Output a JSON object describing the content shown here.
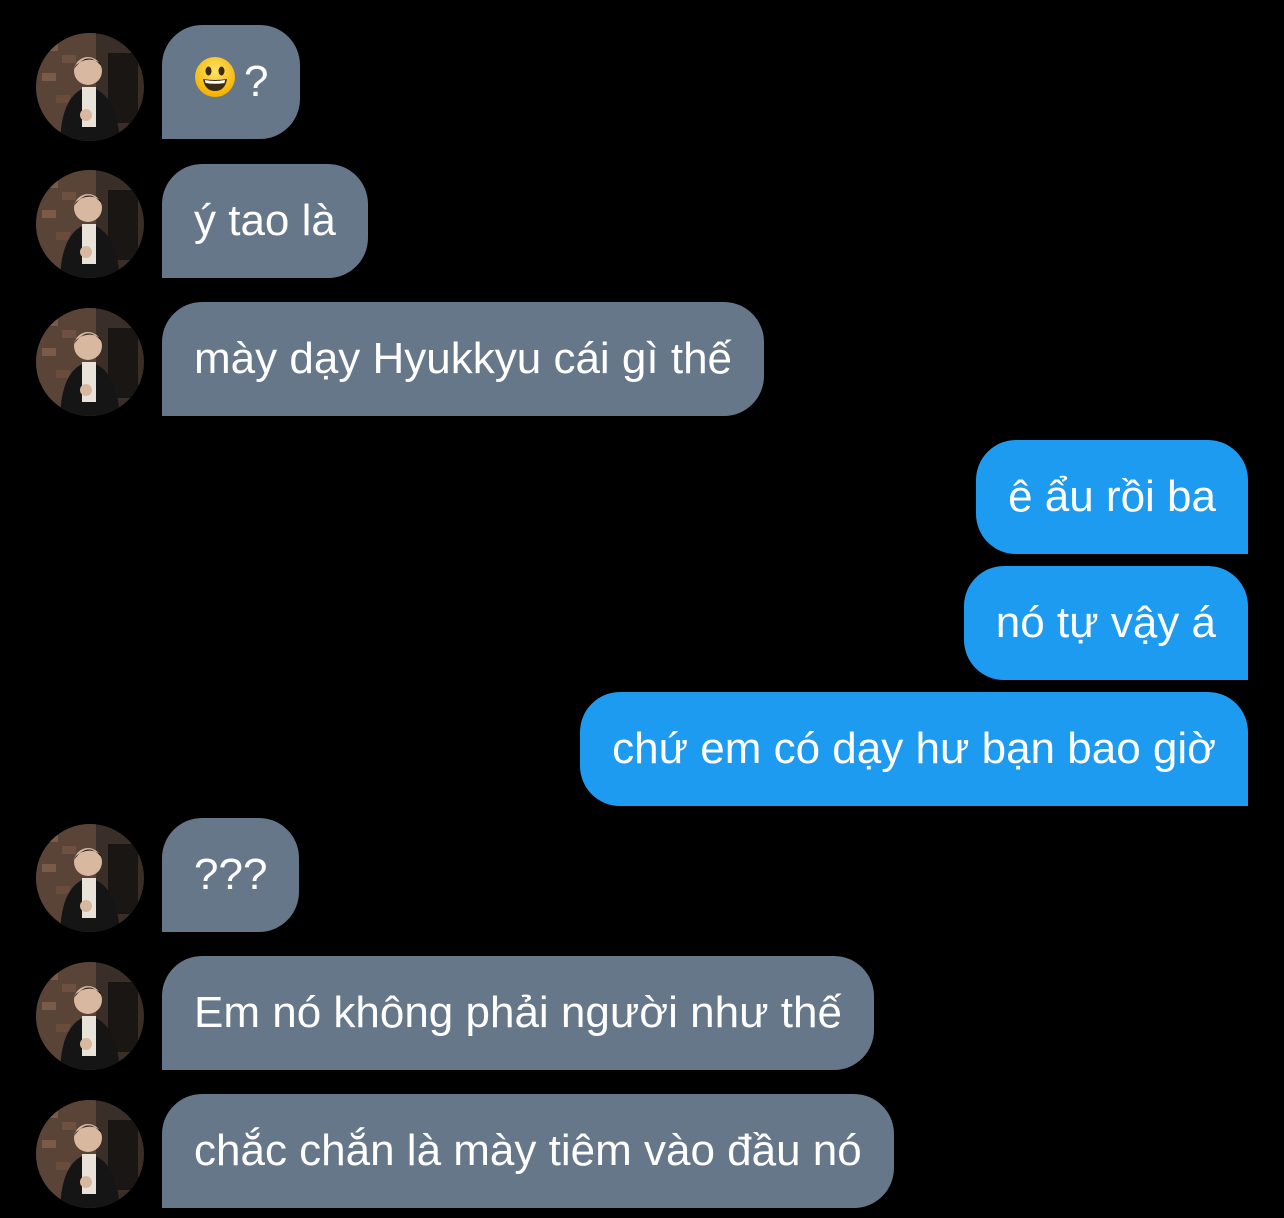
{
  "messages": [
    {
      "sender": "them",
      "emoji": "grinning-face",
      "text": "?"
    },
    {
      "sender": "them",
      "text": "ý tao là"
    },
    {
      "sender": "them",
      "text": "mày dạy Hyukkyu cái gì thế"
    },
    {
      "sender": "me",
      "text": "ê ẩu rồi ba"
    },
    {
      "sender": "me",
      "text": "nó tự vậy á"
    },
    {
      "sender": "me",
      "text": "chứ em có dạy hư bạn bao giờ"
    },
    {
      "sender": "them",
      "text": "???"
    },
    {
      "sender": "them",
      "text": "Em nó không phải người như thế"
    },
    {
      "sender": "them",
      "text": "chắc chắn là mày tiêm vào đầu nó"
    }
  ],
  "colors": {
    "background": "#000000",
    "incoming_bubble": "#66778a",
    "outgoing_bubble": "#1d9bf0",
    "text": "#ffffff"
  }
}
